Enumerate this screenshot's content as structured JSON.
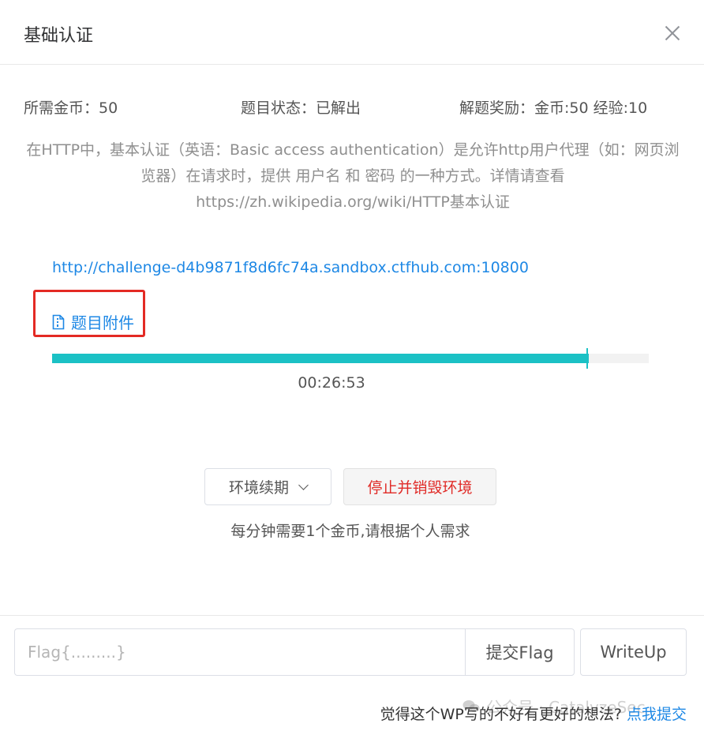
{
  "modal": {
    "title": "基础认证"
  },
  "info": {
    "coins_label": "所需金币：",
    "coins_value": "50",
    "status_label": "题目状态：",
    "status_value": "已解出",
    "reward_label": "解题奖励：",
    "reward_value": "金币:50 经验:10"
  },
  "description": "在HTTP中，基本认证（英语：Basic access authentication）是允许http用户代理（如：网页浏览器）在请求时，提供 用户名 和 密码 的一种方式。详情请查看 https://zh.wikipedia.org/wiki/HTTP基本认证",
  "challenge_url": "http://challenge-d4b9871f8d6fc74a.sandbox.ctfhub.com:10800",
  "attachment_label": "题目附件",
  "timer": {
    "value": "00:26:53",
    "progress_fraction": 0.9
  },
  "actions": {
    "renew_label": "环境续期",
    "destroy_label": "停止并销毁环境",
    "note": "每分钟需要1个金币,请根据个人需求"
  },
  "flag": {
    "placeholder": "Flag{.........}",
    "submit_label": "提交Flag",
    "writeup_label": "WriteUp"
  },
  "feedback": {
    "text": "觉得这个WP写的不好有更好的想法?",
    "link_label": "点我提交"
  },
  "watermark": "公众号 · CatalyzeSec",
  "colors": {
    "accent": "#1e88e5",
    "progress": "#1bc1c5",
    "danger": "#e02b27",
    "success": "#138a1f",
    "highlight_box": "#e32a24"
  }
}
